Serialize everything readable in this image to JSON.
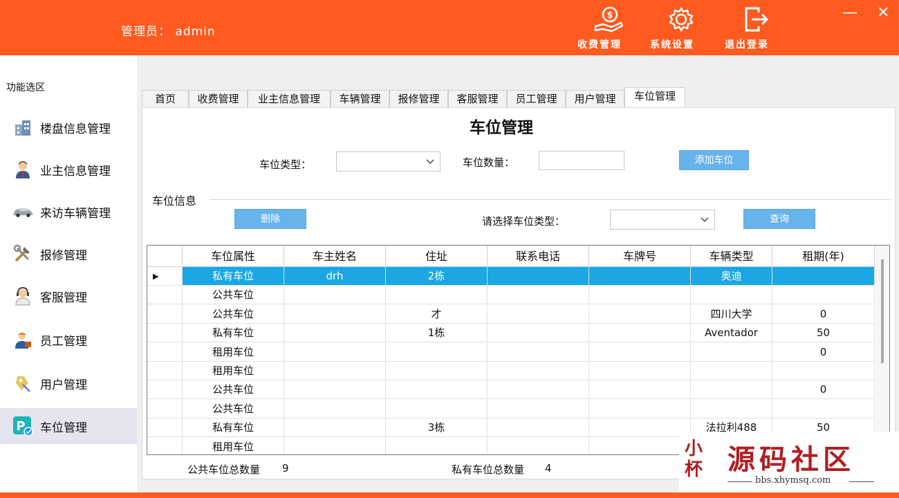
{
  "header": {
    "admin_label": "管理员：  admin",
    "buttons": [
      {
        "label": "收费管理",
        "icon": "hand-money-icon"
      },
      {
        "label": "系统设置",
        "icon": "gear-icon"
      },
      {
        "label": "退出登录",
        "icon": "logout-icon"
      }
    ],
    "minimize": "—",
    "close": "✕"
  },
  "sidebar": {
    "title": "功能选区",
    "items": [
      {
        "label": "楼盘信息管理",
        "icon": "building-icon"
      },
      {
        "label": "业主信息管理",
        "icon": "person-icon"
      },
      {
        "label": "来访车辆管理",
        "icon": "car-icon"
      },
      {
        "label": "报修管理",
        "icon": "tools-icon"
      },
      {
        "label": "客服管理",
        "icon": "headset-person-icon"
      },
      {
        "label": "员工管理",
        "icon": "worker-icon"
      },
      {
        "label": "用户管理",
        "icon": "user-key-icon"
      },
      {
        "label": "车位管理",
        "icon": "parking-icon"
      }
    ]
  },
  "tabs": [
    "首页",
    "收费管理",
    "业主信息管理",
    "车辆管理",
    "报修管理",
    "客服管理",
    "员工管理",
    "用户管理",
    "车位管理"
  ],
  "main": {
    "title": "车位管理",
    "space_type_label": "车位类型：",
    "space_type_value": "",
    "space_count_label": "车位数量：",
    "space_count_value": "",
    "add_button": "添加车位",
    "group_label": "车位信息",
    "delete_button": "删除",
    "filter_label": "请选择车位类型：",
    "filter_value": "",
    "query_button": "查询"
  },
  "grid": {
    "columns": [
      "车位属性",
      "车主姓名",
      "住址",
      "联系电话",
      "车牌号",
      "车辆类型",
      "租期(年)"
    ],
    "rows": [
      [
        "私有车位",
        "drh",
        "2栋",
        "",
        "",
        "奥迪",
        ""
      ],
      [
        "公共车位",
        "",
        "",
        "",
        "",
        "",
        ""
      ],
      [
        "公共车位",
        "",
        "才",
        "",
        "",
        "四川大学",
        "0"
      ],
      [
        "私有车位",
        "",
        "1栋",
        "",
        "",
        "Aventador",
        "50"
      ],
      [
        "租用车位",
        "",
        "",
        "",
        "",
        "",
        "0"
      ],
      [
        "租用车位",
        "",
        "",
        "",
        "",
        "",
        ""
      ],
      [
        "公共车位",
        "",
        "",
        "",
        "",
        "",
        "0"
      ],
      [
        "公共车位",
        "",
        "",
        "",
        "",
        "",
        ""
      ],
      [
        "私有车位",
        "",
        "3栋",
        "",
        "",
        "法拉利488",
        "50"
      ],
      [
        "租用车位",
        "",
        "",
        "",
        "",
        "",
        ""
      ]
    ],
    "selected_row_marker": "▶"
  },
  "footer": {
    "public_label": "公共车位总数量",
    "public_count": "9",
    "private_label": "私有车位总数量",
    "private_count": "4"
  },
  "watermark": {
    "logo_text": "小杯",
    "title": "源码社区",
    "url": "bbs.xhymsq.com"
  }
}
